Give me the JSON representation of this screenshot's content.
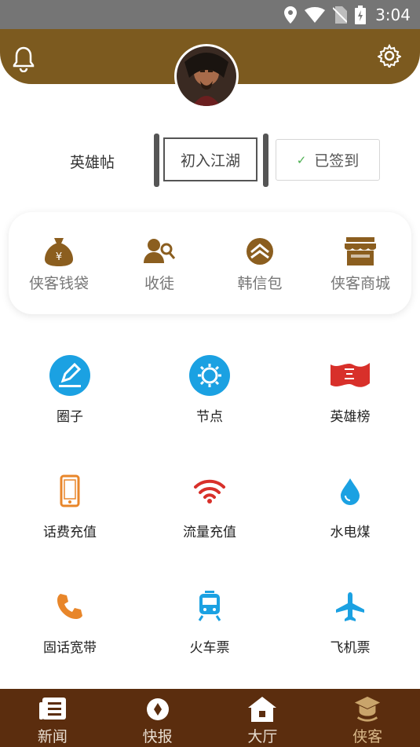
{
  "status_bar": {
    "time": "3:04"
  },
  "hero": {
    "label": "英雄帖",
    "rank": "初入江湖",
    "signed_label": "已签到"
  },
  "wallet": [
    {
      "label": "侠客钱袋",
      "icon": "money-bag-icon"
    },
    {
      "label": "收徒",
      "icon": "disciple-icon"
    },
    {
      "label": "韩信包",
      "icon": "hanxin-icon"
    },
    {
      "label": "侠客商城",
      "icon": "shop-icon"
    }
  ],
  "grid": [
    {
      "label": "圈子",
      "icon": "pencil-circle-icon"
    },
    {
      "label": "节点",
      "icon": "gear-circle-icon"
    },
    {
      "label": "英雄榜",
      "icon": "banner-flag-icon"
    },
    {
      "label": "话费充值",
      "icon": "phone-icon"
    },
    {
      "label": "流量充值",
      "icon": "wifi-icon"
    },
    {
      "label": "水电煤",
      "icon": "water-drop-icon"
    },
    {
      "label": "固话宽带",
      "icon": "telephone-icon"
    },
    {
      "label": "火车票",
      "icon": "train-icon"
    },
    {
      "label": "飞机票",
      "icon": "airplane-icon"
    }
  ],
  "tabs": [
    {
      "label": "新闻",
      "icon": "news-icon"
    },
    {
      "label": "快报",
      "icon": "compass-icon"
    },
    {
      "label": "大厅",
      "icon": "home-icon"
    },
    {
      "label": "侠客",
      "icon": "hero-hat-icon"
    }
  ],
  "colors": {
    "header": "#7c5a1f",
    "tabbar": "#5b2d0e",
    "wallet_icon": "#8b5e1f"
  }
}
